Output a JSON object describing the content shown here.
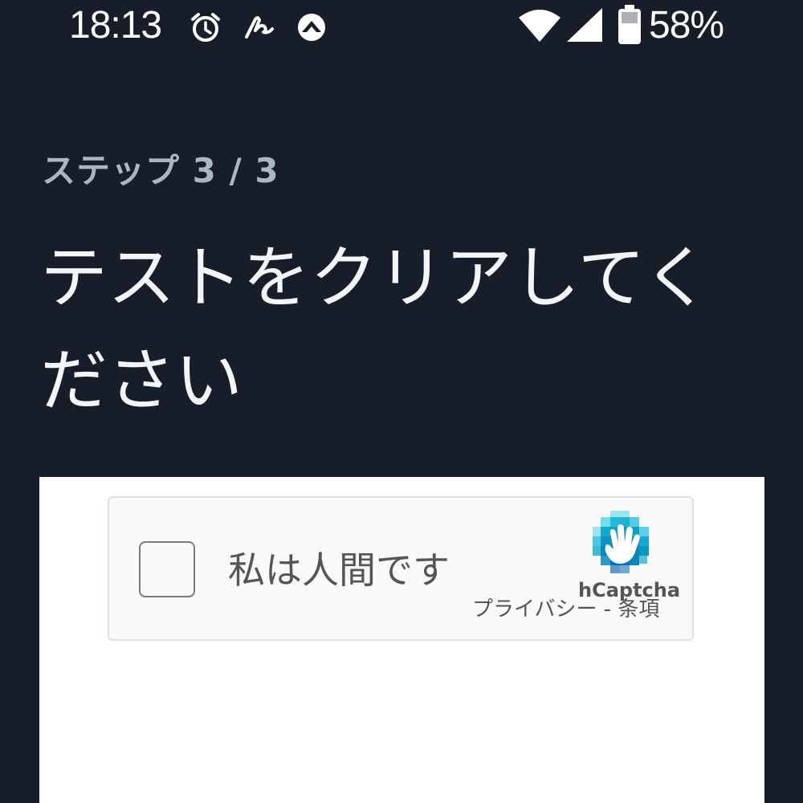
{
  "status_bar": {
    "time": "18:13",
    "battery_percent": "58%",
    "icons": [
      "alarm-icon",
      "signature-icon",
      "app-icon",
      "wifi-icon",
      "cell-signal-icon",
      "battery-icon"
    ]
  },
  "step": {
    "label": "ステップ 3 / 3"
  },
  "title": "テストをクリアしてください",
  "captcha": {
    "label": "私は人間です",
    "brand": "hCaptcha",
    "privacy_link": "プライバシー",
    "separator": " - ",
    "terms_link": "条項",
    "logo_icon": "hcaptcha-logo-icon",
    "brand_colors": {
      "teal": "#0ea1c5",
      "light": "#4fd8ea",
      "dark": "#0074bf"
    }
  },
  "colors": {
    "background": "#171e29",
    "step_text": "#a9b6c6",
    "title_text": "#f3f5f8"
  }
}
